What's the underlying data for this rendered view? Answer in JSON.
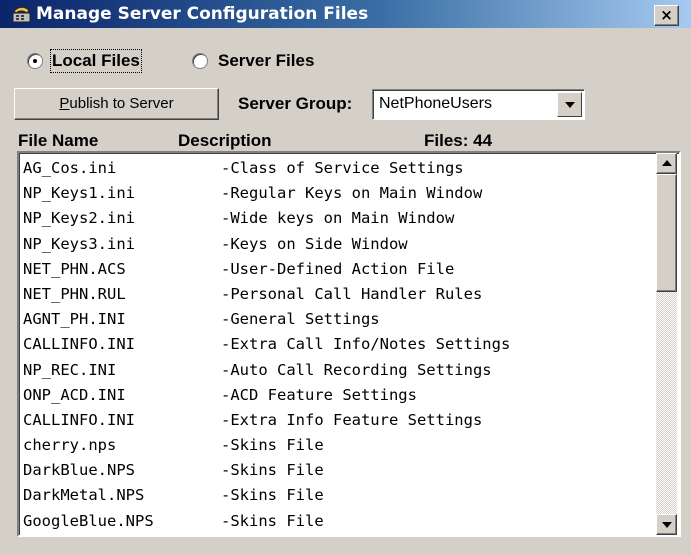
{
  "window": {
    "title": "Manage Server Configuration Files",
    "close_label": "×"
  },
  "source": {
    "options": [
      {
        "label": "Local Files",
        "selected": true
      },
      {
        "label": "Server Files",
        "selected": false
      }
    ]
  },
  "toolbar": {
    "publish_label": "Publish to Server",
    "server_group_label": "Server Group:",
    "server_group_value": "NetPhoneUsers"
  },
  "list": {
    "header_file_name": "File Name",
    "header_description": "Description",
    "header_files_count": "Files: 44",
    "rows": [
      {
        "name": "AG_Cos.ini",
        "desc": "-Class of Service Settings"
      },
      {
        "name": "NP_Keys1.ini",
        "desc": "-Regular Keys on Main Window"
      },
      {
        "name": "NP_Keys2.ini",
        "desc": "-Wide keys on Main Window"
      },
      {
        "name": "NP_Keys3.ini",
        "desc": "-Keys on Side Window"
      },
      {
        "name": "NET_PHN.ACS",
        "desc": "-User-Defined Action File"
      },
      {
        "name": "NET_PHN.RUL",
        "desc": "-Personal Call Handler Rules"
      },
      {
        "name": "AGNT_PH.INI",
        "desc": "-General Settings"
      },
      {
        "name": "CALLINFO.INI",
        "desc": "-Extra Call Info/Notes Settings"
      },
      {
        "name": "NP_REC.INI",
        "desc": "-Auto Call Recording Settings"
      },
      {
        "name": "ONP_ACD.INI",
        "desc": "-ACD Feature Settings"
      },
      {
        "name": "CALLINFO.INI",
        "desc": "-Extra Info Feature Settings"
      },
      {
        "name": "cherry.nps",
        "desc": "-Skins File"
      },
      {
        "name": "DarkBlue.NPS",
        "desc": "-Skins File"
      },
      {
        "name": "DarkMetal.NPS",
        "desc": "-Skins File"
      },
      {
        "name": "GoogleBlue.NPS",
        "desc": "-Skins File"
      }
    ]
  },
  "colors": {
    "title_gradient_start": "#0a246a",
    "title_gradient_end": "#a6caf0",
    "window_bg": "#d4d0c8"
  },
  "icons": {
    "app": "phone-app-icon",
    "close": "close-icon",
    "dropdown": "chevron-down-icon",
    "scroll_up": "scroll-up-arrow-icon",
    "scroll_down": "scroll-down-arrow-icon"
  }
}
